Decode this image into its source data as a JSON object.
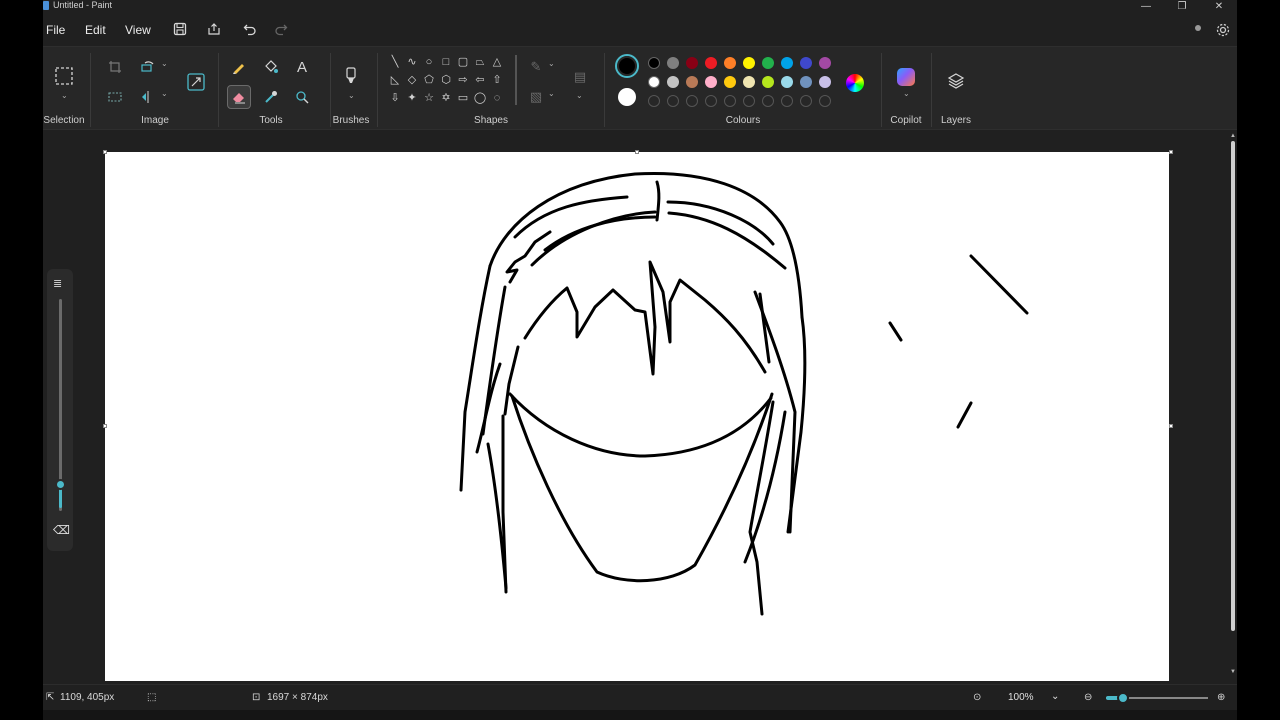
{
  "window": {
    "title": "Untitled - Paint"
  },
  "window_controls": {
    "minimize": "—",
    "restore": "❐",
    "close": "✕"
  },
  "menu": {
    "file": "File",
    "edit": "Edit",
    "view": "View"
  },
  "ribbon": {
    "groups": {
      "selection": "Selection",
      "image": "Image",
      "tools": "Tools",
      "brushes": "Brushes",
      "shapes": "Shapes",
      "colours": "Colours",
      "copilot": "Copilot",
      "layers": "Layers"
    },
    "active_tool": "eraser",
    "primary_color": "#000000",
    "secondary_color": "#ffffff",
    "palette_row1": [
      "#000000",
      "#7f7f7f",
      "#880015",
      "#ed1c24",
      "#ff7f27",
      "#fff200",
      "#22b14c",
      "#00a2e8",
      "#3f48cc",
      "#a349a4"
    ],
    "palette_row2": [
      "#ffffff",
      "#c3c3c3",
      "#b97a57",
      "#ffaec9",
      "#ffc90e",
      "#efe4b0",
      "#b5e61d",
      "#99d9ea",
      "#7092be",
      "#c8bfe7"
    ],
    "custom_colors_empty": 10
  },
  "canvas": {
    "background": "#ffffff",
    "stroke_color": "#000000"
  },
  "size_slider": {
    "level": 0.12
  },
  "status": {
    "cursor_position": "1109, 405px",
    "canvas_size": "1697 × 874px",
    "zoom": "100%",
    "zoom_level": 0.1
  },
  "colors": {
    "accent": "#4bb9c9",
    "window_bg": "#202020",
    "ribbon_bg": "#272727"
  }
}
